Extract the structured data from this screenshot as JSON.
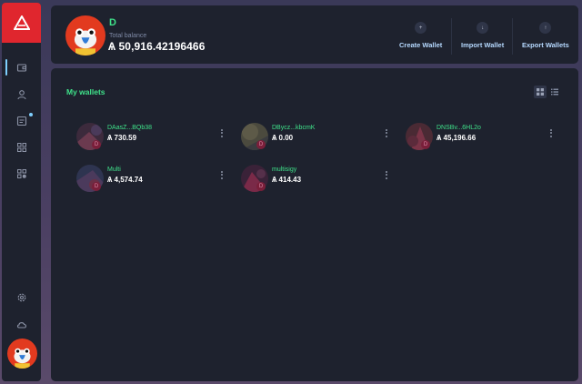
{
  "app": {
    "brand_color": "#e0262e",
    "accent": "#3fe28a",
    "link_color": "#b6d9ff"
  },
  "sidebar": {
    "items": [
      {
        "name": "wallets",
        "icon": "wallet-icon",
        "active": true
      },
      {
        "name": "contacts",
        "icon": "contact-icon"
      },
      {
        "name": "announcements",
        "icon": "news-icon",
        "has_notification": true
      },
      {
        "name": "plugins",
        "icon": "plugin-icon"
      },
      {
        "name": "plugin-manager",
        "icon": "plugin-manager-icon"
      }
    ],
    "bottom": [
      {
        "name": "settings",
        "icon": "gear-icon"
      },
      {
        "name": "network",
        "icon": "cloud-icon"
      }
    ]
  },
  "header": {
    "profile_name": "D",
    "balance_label": "Total balance",
    "balance_value": "Ѧ 50,916.42196466",
    "buttons": [
      {
        "label": "Create Wallet",
        "icon": "plus-icon"
      },
      {
        "label": "Import Wallet",
        "icon": "import-icon"
      },
      {
        "label": "Export Wallets",
        "icon": "export-icon"
      }
    ]
  },
  "main": {
    "title": "My wallets",
    "view_mode": "grid",
    "wallets": [
      {
        "name": "DAasZ...BQb38",
        "balance": "Ѧ 730.59",
        "avatar": "wallet-avatar-1"
      },
      {
        "name": "DBycz...kbcmK",
        "balance": "Ѧ 0.00",
        "avatar": "wallet-avatar-2"
      },
      {
        "name": "DNSBv...6HL2o",
        "balance": "Ѧ 45,196.66",
        "avatar": "wallet-avatar-3"
      },
      {
        "name": "Multi",
        "balance": "Ѧ 4,574.74",
        "avatar": "wallet-avatar-4"
      },
      {
        "name": "multisigy",
        "balance": "Ѧ 414.43",
        "avatar": "wallet-avatar-5"
      }
    ]
  }
}
